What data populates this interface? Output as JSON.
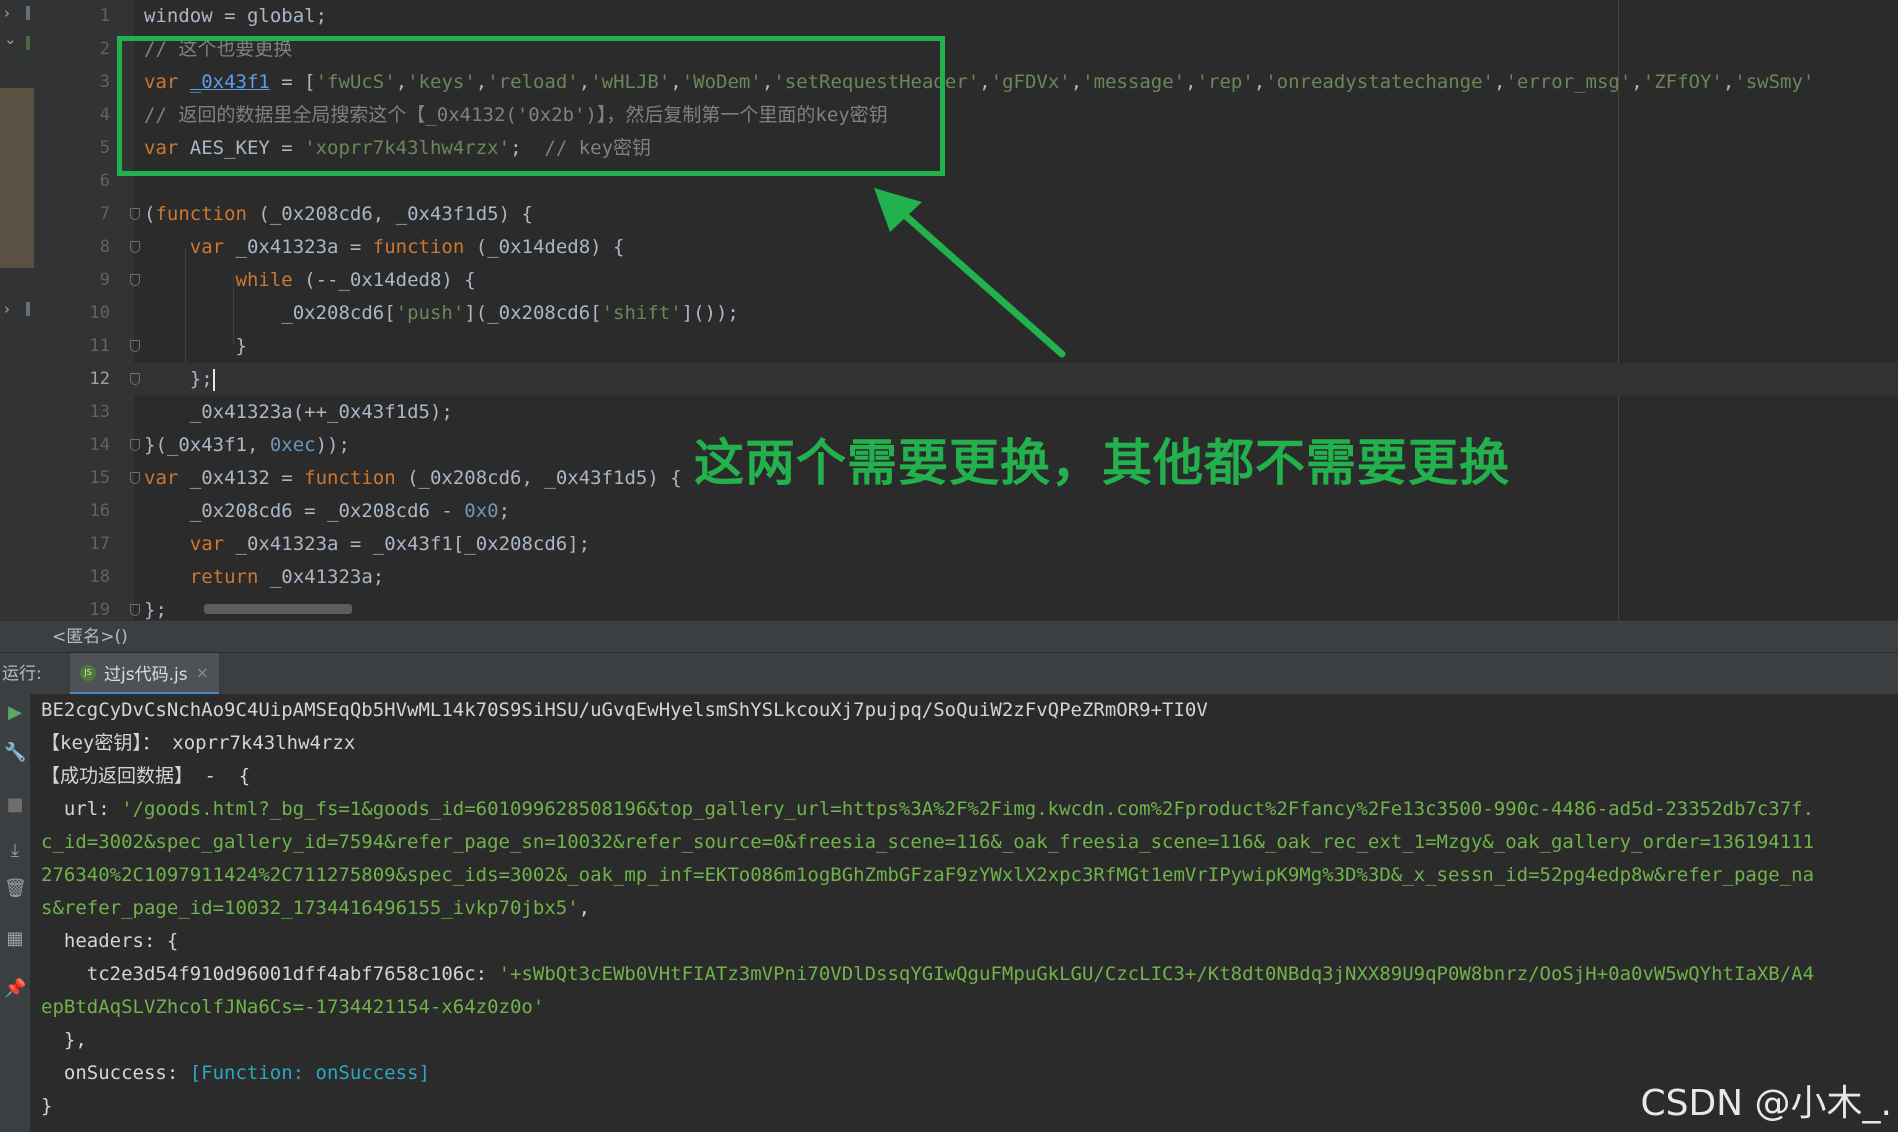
{
  "editor": {
    "lines": [
      {
        "n": "1",
        "tokens": [
          {
            "t": "window = global;",
            "c": ""
          }
        ]
      },
      {
        "n": "2",
        "tokens": [
          {
            "t": "// 这个也要更换",
            "c": "cmt"
          }
        ]
      },
      {
        "n": "3",
        "tokens": [
          {
            "t": "var ",
            "c": "kw"
          },
          {
            "t": "_0x43f1",
            "c": "ref"
          },
          {
            "t": " = [",
            "c": ""
          },
          {
            "t": "'fwUcS'",
            "c": "str"
          },
          {
            "t": ",",
            "c": ""
          },
          {
            "t": "'keys'",
            "c": "str"
          },
          {
            "t": ",",
            "c": ""
          },
          {
            "t": "'reload'",
            "c": "str"
          },
          {
            "t": ",",
            "c": ""
          },
          {
            "t": "'wHLJB'",
            "c": "str"
          },
          {
            "t": ",",
            "c": ""
          },
          {
            "t": "'WoDem'",
            "c": "str"
          },
          {
            "t": ",",
            "c": ""
          },
          {
            "t": "'setRequestHeader'",
            "c": "str"
          },
          {
            "t": ",",
            "c": ""
          },
          {
            "t": "'gFDVx'",
            "c": "str"
          },
          {
            "t": ",",
            "c": ""
          },
          {
            "t": "'message'",
            "c": "str"
          },
          {
            "t": ",",
            "c": ""
          },
          {
            "t": "'rep'",
            "c": "str"
          },
          {
            "t": ",",
            "c": ""
          },
          {
            "t": "'onreadystatechange'",
            "c": "str"
          },
          {
            "t": ",",
            "c": ""
          },
          {
            "t": "'error_msg'",
            "c": "str"
          },
          {
            "t": ",",
            "c": ""
          },
          {
            "t": "'ZFfOY'",
            "c": "str"
          },
          {
            "t": ",",
            "c": ""
          },
          {
            "t": "'swSmy'",
            "c": "str"
          }
        ]
      },
      {
        "n": "4",
        "tokens": [
          {
            "t": "// 返回的数据里全局搜索这个【_0x4132('0x2b')】，然后复制第一个里面的key密钥",
            "c": "cmt"
          }
        ]
      },
      {
        "n": "5",
        "tokens": [
          {
            "t": "var ",
            "c": "kw"
          },
          {
            "t": "AES_KEY = ",
            "c": ""
          },
          {
            "t": "'xoprr7k43lhw4rzx'",
            "c": "str"
          },
          {
            "t": ";  ",
            "c": ""
          },
          {
            "t": "// key密钥",
            "c": "cmt"
          }
        ]
      },
      {
        "n": "6",
        "tokens": []
      },
      {
        "n": "7",
        "tokens": [
          {
            "t": "(",
            "c": ""
          },
          {
            "t": "function ",
            "c": "kw"
          },
          {
            "t": "(_0x208cd6, _0x43f1d5) {",
            "c": ""
          }
        ]
      },
      {
        "n": "8",
        "tokens": [
          {
            "t": "    var ",
            "c": "kw"
          },
          {
            "t": "_0x41323a = ",
            "c": ""
          },
          {
            "t": "function ",
            "c": "kw"
          },
          {
            "t": "(_0x14ded8) {",
            "c": ""
          }
        ]
      },
      {
        "n": "9",
        "tokens": [
          {
            "t": "        while ",
            "c": "kw"
          },
          {
            "t": "(--_0x14ded8) {",
            "c": ""
          }
        ]
      },
      {
        "n": "10",
        "tokens": [
          {
            "t": "            _0x208cd6[",
            "c": ""
          },
          {
            "t": "'push'",
            "c": "str"
          },
          {
            "t": "](_0x208cd6[",
            "c": ""
          },
          {
            "t": "'shift'",
            "c": "str"
          },
          {
            "t": "]());",
            "c": ""
          }
        ]
      },
      {
        "n": "11",
        "tokens": [
          {
            "t": "        }",
            "c": ""
          }
        ]
      },
      {
        "n": "12",
        "tokens": [
          {
            "t": "    };",
            "c": ""
          }
        ]
      },
      {
        "n": "13",
        "tokens": [
          {
            "t": "    _0x41323a(++_0x43f1d5);",
            "c": ""
          }
        ]
      },
      {
        "n": "14",
        "tokens": [
          {
            "t": "}(_0x43f1, ",
            "c": ""
          },
          {
            "t": "0xec",
            "c": "num"
          },
          {
            "t": "));",
            "c": ""
          }
        ]
      },
      {
        "n": "15",
        "tokens": [
          {
            "t": "var ",
            "c": "kw"
          },
          {
            "t": "_0x4132 = ",
            "c": ""
          },
          {
            "t": "function ",
            "c": "kw"
          },
          {
            "t": "(_0x208cd6, _0x43f1d5) {",
            "c": ""
          }
        ]
      },
      {
        "n": "16",
        "tokens": [
          {
            "t": "    _0x208cd6 = _0x208cd6 - ",
            "c": ""
          },
          {
            "t": "0x0",
            "c": "num"
          },
          {
            "t": ";",
            "c": ""
          }
        ]
      },
      {
        "n": "17",
        "tokens": [
          {
            "t": "    var ",
            "c": "kw"
          },
          {
            "t": "_0x41323a = _0x43f1[_0x208cd6];",
            "c": ""
          }
        ]
      },
      {
        "n": "18",
        "tokens": [
          {
            "t": "    return ",
            "c": "kw"
          },
          {
            "t": "_0x41323a;",
            "c": ""
          }
        ]
      },
      {
        "n": "19",
        "tokens": [
          {
            "t": "};",
            "c": ""
          }
        ]
      }
    ]
  },
  "annotation": {
    "text": "这两个需要更换，其他都不需要更换"
  },
  "breadcrumb": {
    "label": "<匿名>()"
  },
  "run_panel": {
    "label": "运行:",
    "tab_label": "过js代码.js",
    "js_icon_text": "JS"
  },
  "console": {
    "lines": [
      [
        {
          "t": "BE2cgCyDvCsNchAo9C4UipAMSEqQb5HVwML14k70S9SiHSU/uGvqEwHyelsmShYSLkcouXj7pujpq/SoQuiW2zFvQPeZRmOR9+TI0V",
          "c": ""
        }
      ],
      [
        {
          "t": "【key密钥】： xoprr7k43lhw4rzx",
          "c": ""
        }
      ],
      [
        {
          "t": "【成功返回数据】 -  {",
          "c": ""
        }
      ],
      [
        {
          "t": "  url: ",
          "c": ""
        },
        {
          "t": "'/goods.html?_bg_fs=1&goods_id=601099628508196&top_gallery_url=https%3A%2F%2Fimg.kwcdn.com%2Fproduct%2Ffancy%2Fe13c3500-990c-4486-ad5d-23352db7c37f.",
          "c": "g"
        }
      ],
      [
        {
          "t": "c_id=3002&spec_gallery_id=7594&refer_page_sn=10032&refer_source=0&freesia_scene=116&_oak_freesia_scene=116&_oak_rec_ext_1=Mzgy&_oak_gallery_order=136194111",
          "c": "g"
        }
      ],
      [
        {
          "t": "276340%2C1097911424%2C711275809&spec_ids=3002&_oak_mp_inf=EKTo086m1ogBGhZmbGFzaF9zYWxlX2xpc3RfMGt1emVrIPywipK9Mg%3D%3D&_x_sessn_id=52pg4edp8w&refer_page_na",
          "c": "g"
        }
      ],
      [
        {
          "t": "s&refer_page_id=10032_1734416496155_ivkp70jbx5'",
          "c": "g"
        },
        {
          "t": ",",
          "c": ""
        }
      ],
      [
        {
          "t": "  headers: {",
          "c": ""
        }
      ],
      [
        {
          "t": "    tc2e3d54f910d96001dff4abf7658c106c: ",
          "c": ""
        },
        {
          "t": "'+sWbQt3cEWb0VHtFIATz3mVPni70VDlDssqYGIwQguFMpuGkLGU/CzcLIC3+/Kt8dt0NBdq3jNXX89U9qP0W8bnrz/OoSjH+0a0vW5wQYhtIaXB/A4",
          "c": "g"
        }
      ],
      [
        {
          "t": "epBtdAqSLVZhcolfJNa6Cs=-1734421154-x64z0z0o'",
          "c": "g"
        }
      ],
      [
        {
          "t": "  },",
          "c": ""
        }
      ],
      [
        {
          "t": "  onSuccess: ",
          "c": ""
        },
        {
          "t": "[Function: onSuccess]",
          "c": "c"
        }
      ],
      [
        {
          "t": "}",
          "c": ""
        }
      ]
    ]
  },
  "watermark": {
    "text": "CSDN @小木_."
  },
  "icons": {
    "run": "play-icon",
    "wrench": "wrench-icon",
    "stop": "stop-icon",
    "scroll": "scroll-to-end-icon",
    "trash": "trash-icon",
    "layout": "layout-icon",
    "pin": "pin-icon"
  },
  "colors": {
    "annotation_green": "#22b14c",
    "keyword": "#cc7832",
    "string": "#6a8759",
    "comment": "#808080"
  }
}
